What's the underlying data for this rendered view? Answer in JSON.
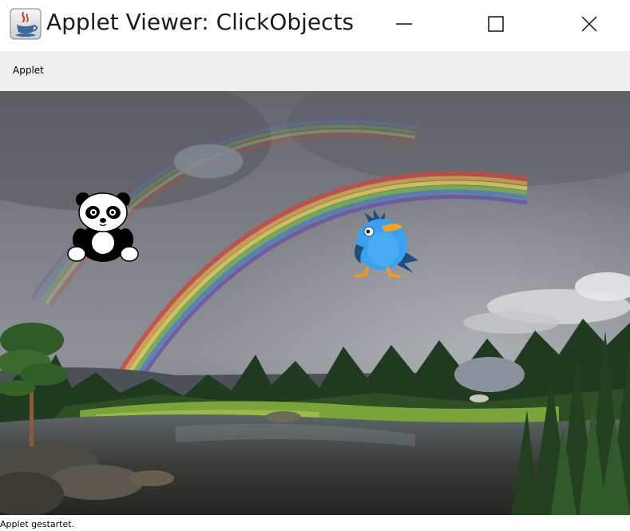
{
  "window": {
    "title": "Applet Viewer: ClickObjects",
    "app_icon": "java-coffee-cup-icon",
    "controls": [
      "minimize-icon",
      "maximize-icon",
      "close-icon"
    ]
  },
  "menu": {
    "applet_label": "Applet"
  },
  "canvas": {
    "background": "rainbow-landscape-photo",
    "objects": [
      {
        "kind": "ellipse",
        "color": "#848a96"
      },
      {
        "kind": "panda-image"
      },
      {
        "kind": "bird-image"
      },
      {
        "kind": "ellipse",
        "color": "#8a909c"
      }
    ]
  },
  "status": {
    "text": "Applet gestartet."
  }
}
